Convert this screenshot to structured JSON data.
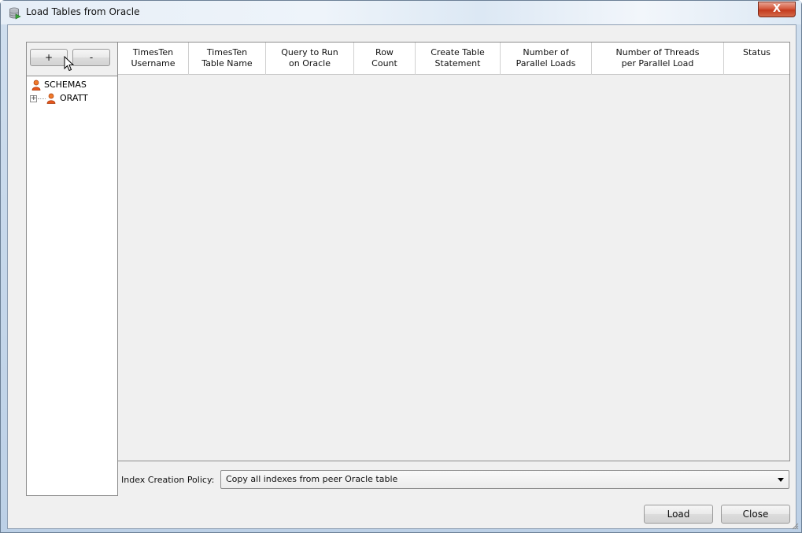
{
  "window": {
    "title": "Load Tables from Oracle",
    "close_label": "X"
  },
  "left_panel": {
    "add_button_label": "+",
    "remove_button_label": "-",
    "tree": {
      "root_label": "SCHEMAS",
      "child_label": "ORATT"
    }
  },
  "table": {
    "columns": [
      {
        "label": "TimesTen\nUsername"
      },
      {
        "label": "TimesTen\nTable Name"
      },
      {
        "label": "Query to Run\non Oracle"
      },
      {
        "label": "Row\nCount"
      },
      {
        "label": "Create Table\nStatement"
      },
      {
        "label": "Number of\nParallel Loads"
      },
      {
        "label": "Number of Threads\nper Parallel Load"
      },
      {
        "label": "Status"
      }
    ],
    "rows": []
  },
  "policy": {
    "label": "Index Creation Policy:",
    "selected_value": "Copy all indexes from peer Oracle table"
  },
  "footer": {
    "load_label": "Load",
    "close_label": "Close"
  },
  "colors": {
    "titlebar": "#e6eef7",
    "close_button": "#c43a1e",
    "client_bg": "#f0f0f0",
    "person_icon": "#e8561c"
  }
}
